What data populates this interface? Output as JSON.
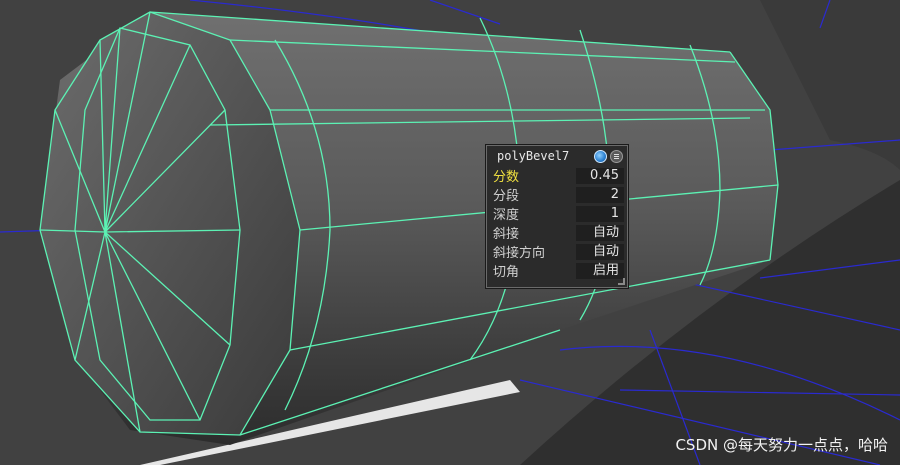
{
  "hud": {
    "node_name": "polyBevel7",
    "attributes": [
      {
        "label": "分数",
        "value": "0.45",
        "active": true
      },
      {
        "label": "分段",
        "value": "2",
        "active": false
      },
      {
        "label": "深度",
        "value": "1",
        "active": false
      },
      {
        "label": "斜接",
        "value": "自动",
        "active": false
      },
      {
        "label": "斜接方向",
        "value": "自动",
        "active": false
      },
      {
        "label": "切角",
        "value": "启用",
        "active": false
      }
    ]
  },
  "watermark": "CSDN @每天努力一点点，哈哈",
  "colors": {
    "viewport_bg": "#3d3d3d",
    "wireframe": "#5cf2b4",
    "scene_lines": "#2a2ad0",
    "active_label": "#f0e040"
  },
  "icons": [
    "globe-icon",
    "menu-icon"
  ]
}
